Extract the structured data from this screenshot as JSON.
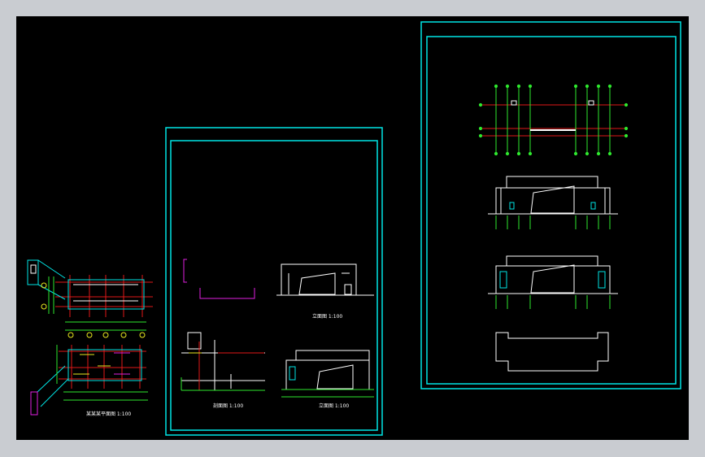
{
  "app": {
    "window_title": "",
    "background": "#c9ccd1",
    "canvas_background": "#000000"
  },
  "colors": {
    "frame": "#00e5e5",
    "grid_axis": "#e01818",
    "dimension": "#2ee82e",
    "outline": "#ffffff",
    "highlight": "#e020e0",
    "accent_yellow": "#e8e820"
  },
  "sheets": [
    {
      "id": "sheet-left-plans",
      "labels": {
        "plan_title": "某某某平面图 1:100"
      }
    },
    {
      "id": "sheet-middle",
      "labels": {
        "elevation_a": "立面图 1:100",
        "section": "剖面图 1:100",
        "elevation_b": "立面图 1:100"
      }
    },
    {
      "id": "sheet-right",
      "labels": {}
    }
  ]
}
